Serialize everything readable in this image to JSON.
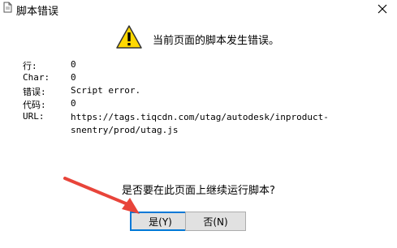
{
  "window": {
    "title": "脚本错误",
    "icon": "document-icon",
    "close_glyph": "×"
  },
  "header": {
    "icon": "warning-icon",
    "text": "当前页面的脚本发生错误。"
  },
  "details": [
    {
      "label": "行:",
      "value": "0"
    },
    {
      "label": "Char:",
      "value": "0"
    },
    {
      "label": "错误:",
      "value": "Script error."
    },
    {
      "label": "代码:",
      "value": "0"
    },
    {
      "label": "URL:",
      "value": "https://tags.tiqcdn.com/utag/autodesk/inproduct-snentry/prod/utag.js"
    }
  ],
  "question": "是否要在此页面上继续运行脚本?",
  "buttons": {
    "yes_label": "是(Y)",
    "no_label": "否(N)"
  },
  "colors": {
    "warning_fill": "#ffd800",
    "arrow": "#e8443a",
    "default_button_border": "#0078d7"
  }
}
